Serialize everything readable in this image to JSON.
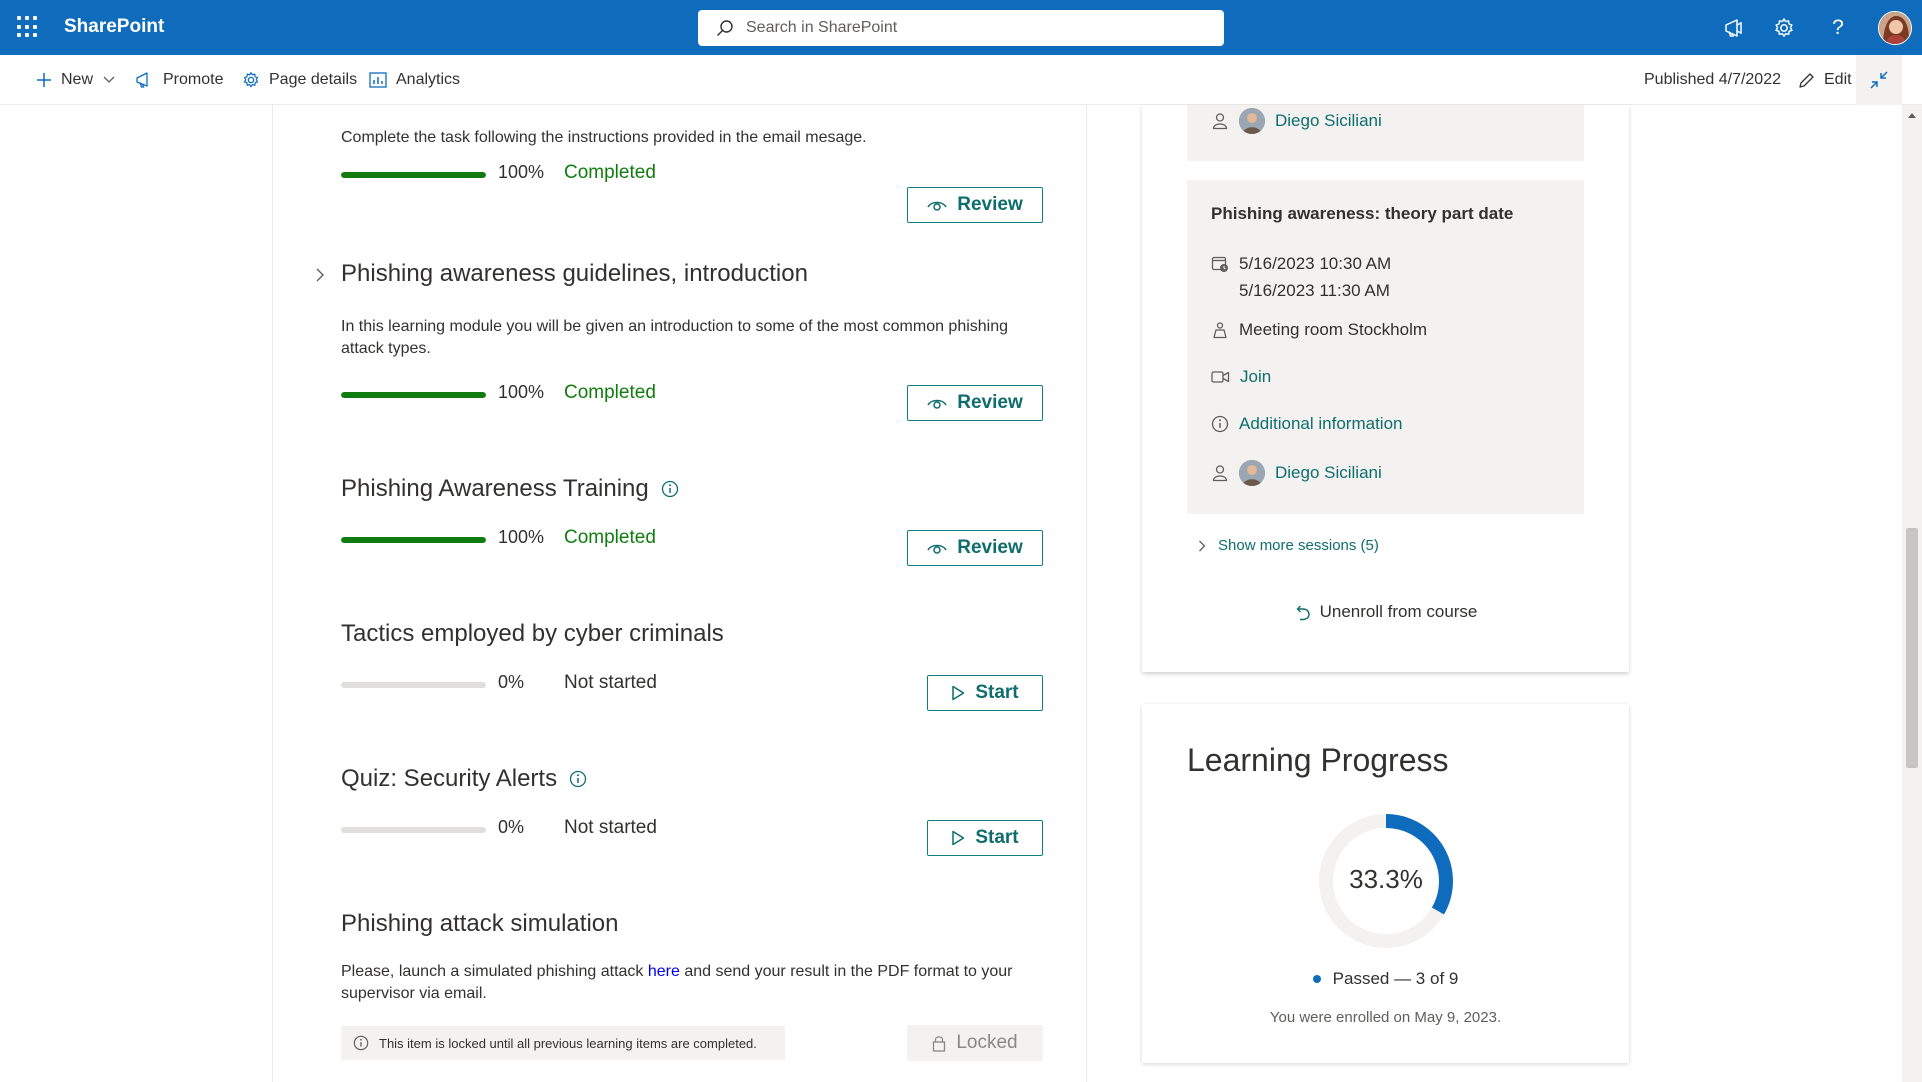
{
  "suite_bar": {
    "app_name": "SharePoint",
    "search_placeholder": "Search in SharePoint",
    "accent_color": "#0f6cbd"
  },
  "command_bar": {
    "new_label": "New",
    "promote_label": "Promote",
    "page_details_label": "Page details",
    "analytics_label": "Analytics",
    "published_text": "Published 4/7/2022",
    "edit_label": "Edit"
  },
  "learning_items": [
    {
      "description": "Complete the task following the instructions provided in the email mesage.",
      "progress": 100,
      "progress_text": "100%",
      "status": "Completed",
      "action": "Review"
    },
    {
      "title": "Phishing awareness guidelines, introduction",
      "description": "In this learning module you will be given an introduction to some of the most common phishing attack types.",
      "progress": 100,
      "progress_text": "100%",
      "status": "Completed",
      "action": "Review"
    },
    {
      "title": "Phishing Awareness Training",
      "progress": 100,
      "progress_text": "100%",
      "status": "Completed",
      "action": "Review"
    },
    {
      "title": "Tactics employed by cyber criminals",
      "progress": 0,
      "progress_text": "0%",
      "status": "Not started",
      "action": "Start"
    },
    {
      "title": "Quiz: Security Alerts",
      "progress": 0,
      "progress_text": "0%",
      "status": "Not started",
      "action": "Start"
    },
    {
      "title": "Phishing attack simulation",
      "description_before": "Please, launch a simulated phishing attack ",
      "description_link": "here",
      "description_after": " and send your result in the PDF format to your supervisor via email.",
      "locked_note": "This item is locked until all previous learning items are completed.",
      "action": "Locked"
    }
  ],
  "sessions": {
    "prev_organizer": "Diego Siciliani",
    "session": {
      "title": "Phishing awareness: theory part date",
      "start": "5/16/2023 10:30 AM",
      "end": "5/16/2023 11:30 AM",
      "location": "Meeting room Stockholm",
      "join_label": "Join",
      "info_label": "Additional information",
      "organizer": "Diego Siciliani"
    },
    "show_more_label": "Show more sessions (5)",
    "unenroll_label": "Unenroll from course"
  },
  "learning_progress": {
    "title": "Learning Progress",
    "percent_text": "33.3%",
    "passed": 3,
    "total": 9,
    "legend_text": "Passed — 3 of 9",
    "enrolled_text": "You were enrolled on May 9, 2023.",
    "ring_color": "#0f6cbd"
  }
}
